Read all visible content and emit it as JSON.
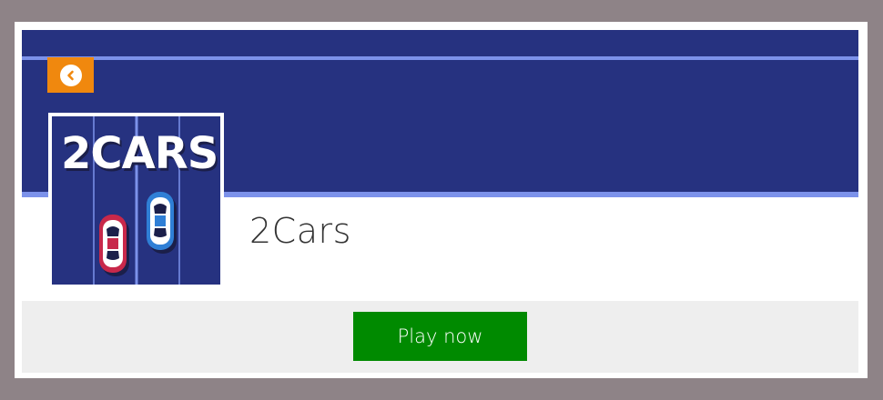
{
  "game": {
    "title": "2Cars",
    "thumbnail_text": "2CARS"
  },
  "actions": {
    "play_label": "Play now",
    "back_icon": "chevron-left-circle-icon"
  },
  "colors": {
    "page_bg": "#8e8387",
    "banner": "#263280",
    "banner_accent": "#7c92ea",
    "back_button": "#f0880e",
    "play_button": "#008a00",
    "play_bar": "#eeeeee"
  }
}
